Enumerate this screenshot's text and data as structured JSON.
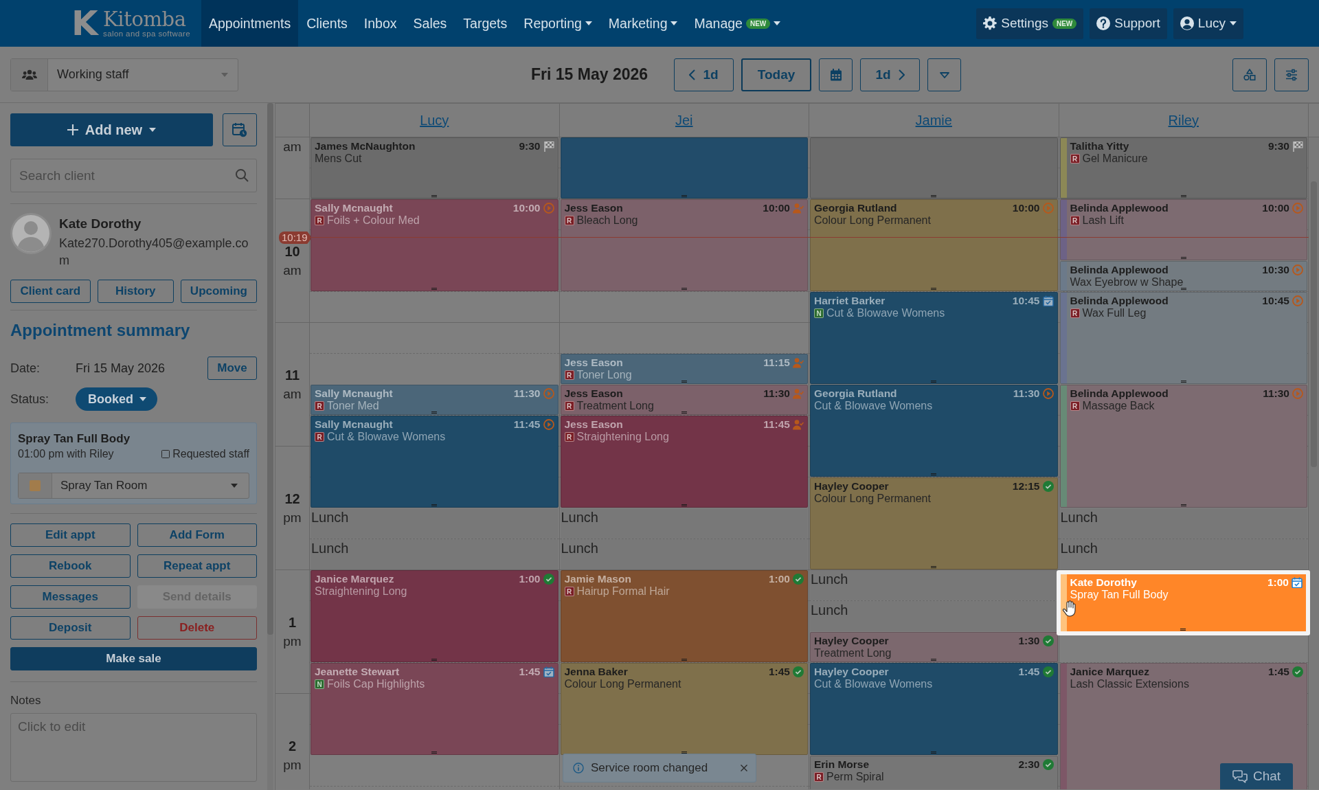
{
  "nav": {
    "logo": {
      "mark": "K",
      "name": "Kitomba",
      "tagline": "salon and spa software"
    },
    "items": [
      {
        "label": "Appointments",
        "selected": true,
        "menu": false
      },
      {
        "label": "Clients",
        "selected": false,
        "menu": false
      },
      {
        "label": "Inbox",
        "selected": false,
        "menu": false
      },
      {
        "label": "Sales",
        "selected": false,
        "menu": false
      },
      {
        "label": "Targets",
        "selected": false,
        "menu": false
      },
      {
        "label": "Reporting",
        "selected": false,
        "menu": true
      },
      {
        "label": "Marketing",
        "selected": false,
        "menu": true
      },
      {
        "label": "Manage",
        "selected": false,
        "menu": true,
        "badge": "NEW"
      }
    ],
    "settings": {
      "label": "Settings",
      "badge": "NEW"
    },
    "support": {
      "label": "Support"
    },
    "user": {
      "label": "Lucy"
    }
  },
  "toolbar": {
    "staff_filter": "Working staff",
    "date": "Fri 15 May 2026",
    "prev_day": "1d",
    "today": "Today",
    "next_day": "1d"
  },
  "sidebar": {
    "add_new": "Add new",
    "search": {
      "placeholder": "Search client"
    },
    "client": {
      "name": "Kate Dorothy",
      "email": "Kate270.Dorothy405@example.com"
    },
    "client_buttons": [
      "Client card",
      "History",
      "Upcoming"
    ],
    "summary": {
      "title": "Appointment summary",
      "date_label": "Date:",
      "date": "Fri 15 May 2026",
      "move": "Move",
      "status_label": "Status:",
      "status": "Booked"
    },
    "service": {
      "name": "Spray Tan Full Body",
      "detail": "01:00 pm with Riley",
      "requested_staff": {
        "label": "Requested staff",
        "checked": false
      },
      "room": {
        "name": "Spray Tan Room",
        "color": "#a27c4b"
      }
    },
    "actions": [
      {
        "label": "Edit appt",
        "kind": "outline",
        "disabled": false
      },
      {
        "label": "Add Form",
        "kind": "outline",
        "disabled": false
      },
      {
        "label": "Rebook",
        "kind": "outline",
        "disabled": false
      },
      {
        "label": "Repeat appt",
        "kind": "outline",
        "disabled": false
      },
      {
        "label": "Messages",
        "kind": "outline",
        "disabled": false
      },
      {
        "label": "Send details",
        "kind": "outline",
        "disabled": true
      },
      {
        "label": "Deposit",
        "kind": "outline",
        "disabled": false
      },
      {
        "label": "Delete",
        "kind": "danger",
        "disabled": false
      },
      {
        "label": "Make sale",
        "kind": "primary",
        "disabled": false
      }
    ],
    "notes": {
      "label": "Notes",
      "placeholder": "Click to edit"
    }
  },
  "calendar": {
    "current_time": "10:19",
    "time_labels": [
      {
        "period": "am"
      },
      {
        "hour": "10",
        "period": "am"
      },
      {
        "hour": "11",
        "period": "am"
      },
      {
        "hour": "12",
        "period": "pm"
      },
      {
        "hour": "1",
        "period": "pm"
      },
      {
        "hour": "2",
        "period": "pm"
      }
    ],
    "columns": [
      {
        "staff": "Lucy",
        "appointments": [
          {
            "kind": "appointment",
            "client": "James McNaughton",
            "time": "9:30",
            "status": {
              "kind": "completed"
            },
            "service": "Mens Cut",
            "color": "#6b6b6b",
            "selected": false
          },
          {
            "kind": "appointment",
            "client": "Sally Mcnaught",
            "time": "10:00",
            "status": {
              "kind": "started"
            },
            "badge": {
              "letter": "R",
              "kind": "rebooked"
            },
            "service": "Foils + Colour Med",
            "color": "#7a4656",
            "selected": false
          },
          {
            "kind": "appointment",
            "client": "Sally Mcnaught",
            "time": "11:30",
            "status": {
              "kind": "started"
            },
            "badge": {
              "letter": "R",
              "kind": "rebooked"
            },
            "service": "Toner Med",
            "color": "#4b6679",
            "selected": false
          },
          {
            "kind": "appointment",
            "client": "Sally Mcnaught",
            "time": "11:45",
            "status": {
              "kind": "started"
            },
            "badge": {
              "letter": "R",
              "kind": "rebooked"
            },
            "service": "Cut & Blowave Womens",
            "color": "#1f4b68",
            "selected": false
          },
          {
            "kind": "break",
            "label": "Lunch",
            "selected": false
          },
          {
            "kind": "break",
            "label": "Lunch",
            "selected": false
          },
          {
            "kind": "appointment",
            "client": "Janice Marquez",
            "time": "1:00",
            "status": {
              "kind": "arrived"
            },
            "service": "Straightening Long",
            "color": "#733448",
            "selected": false
          },
          {
            "kind": "appointment",
            "client": "Jeanette Stewart",
            "time": "1:45",
            "status": {
              "kind": "confirmed"
            },
            "badge": {
              "letter": "N",
              "kind": "new_client"
            },
            "service": "Foils Cap Highlights",
            "color": "#7a4656",
            "selected": false
          }
        ]
      },
      {
        "staff": "Jei",
        "appointments": [
          {
            "kind": "blank",
            "color": "#224c6a",
            "selected": false
          },
          {
            "kind": "appointment",
            "client": "Jess Eason",
            "time": "10:00",
            "status": {
              "kind": "requested"
            },
            "badge": {
              "letter": "R",
              "kind": "rebooked"
            },
            "service": "Bleach Long",
            "color": "#7c616a",
            "selected": false
          },
          {
            "kind": "appointment",
            "client": "Jess Eason",
            "time": "11:15",
            "status": {
              "kind": "requested"
            },
            "badge": {
              "letter": "R",
              "kind": "rebooked"
            },
            "service": "Toner Long",
            "color": "#4b6679",
            "selected": false
          },
          {
            "kind": "appointment",
            "client": "Jess Eason",
            "time": "11:30",
            "status": {
              "kind": "requested"
            },
            "badge": {
              "letter": "R",
              "kind": "rebooked"
            },
            "service": "Treatment Long",
            "color": "#7c616a",
            "selected": false
          },
          {
            "kind": "appointment",
            "client": "Jess Eason",
            "time": "11:45",
            "status": {
              "kind": "requested"
            },
            "badge": {
              "letter": "R",
              "kind": "rebooked"
            },
            "service": "Straightening Long",
            "color": "#733448",
            "selected": false
          },
          {
            "kind": "break",
            "label": "Lunch",
            "selected": false
          },
          {
            "kind": "break",
            "label": "Lunch",
            "selected": false
          },
          {
            "kind": "appointment",
            "client": "Jamie Mason",
            "time": "1:00",
            "status": {
              "kind": "arrived"
            },
            "badge": {
              "letter": "R",
              "kind": "rebooked"
            },
            "service": "Hairup Formal Hair",
            "color": "#7f5030",
            "selected": false
          },
          {
            "kind": "appointment",
            "client": "Jenna Baker",
            "time": "1:45",
            "status": {
              "kind": "arrived"
            },
            "service": "Colour Long Permanent",
            "color": "#7f704b",
            "selected": false
          }
        ]
      },
      {
        "staff": "Jamie",
        "appointments": [
          {
            "kind": "blank",
            "color": "#6b6b6b",
            "selected": false
          },
          {
            "kind": "appointment",
            "client": "Georgia Rutland",
            "time": "10:00",
            "status": {
              "kind": "started"
            },
            "service": "Colour Long Permanent",
            "color": "#7f704b",
            "selected": false
          },
          {
            "kind": "appointment",
            "client": "Harriet Barker",
            "time": "10:45",
            "status": {
              "kind": "confirmed"
            },
            "badge": {
              "letter": "N",
              "kind": "new_client"
            },
            "service": "Cut & Blowave Womens",
            "color": "#1f4b68",
            "selected": false
          },
          {
            "kind": "appointment",
            "client": "Georgia Rutland",
            "time": "11:30",
            "status": {
              "kind": "started"
            },
            "service": "Cut & Blowave Womens",
            "color": "#1f4b68",
            "selected": false
          },
          {
            "kind": "appointment",
            "client": "Hayley Cooper",
            "time": "12:15",
            "status": {
              "kind": "arrived"
            },
            "service": "Colour Long Permanent",
            "color": "#7f704b",
            "selected": false
          },
          {
            "kind": "break",
            "label": "Lunch",
            "selected": false
          },
          {
            "kind": "break",
            "label": "Lunch",
            "selected": false
          },
          {
            "kind": "appointment",
            "client": "Hayley Cooper",
            "time": "1:30",
            "status": {
              "kind": "arrived"
            },
            "service": "Treatment Long",
            "color": "#7c686e",
            "selected": false
          },
          {
            "kind": "appointment",
            "client": "Hayley Cooper",
            "time": "1:45",
            "status": {
              "kind": "arrived"
            },
            "service": "Cut & Blowave Womens",
            "color": "#1f4b68",
            "selected": false
          },
          {
            "kind": "appointment",
            "client": "Erin Morse",
            "time": "2:30",
            "status": {
              "kind": "arrived"
            },
            "badge": {
              "letter": "R",
              "kind": "rebooked"
            },
            "service": "Perm Spiral",
            "color": "#767676",
            "selected": false
          }
        ]
      },
      {
        "staff": "Riley",
        "appointments": [
          {
            "kind": "appointment",
            "client": "Talitha Yitty",
            "time": "9:30",
            "status": {
              "kind": "completed"
            },
            "badge": {
              "letter": "R",
              "kind": "rebooked"
            },
            "service": "Gel Manicure",
            "color": "#6b6b6b",
            "stripe": {
              "color": "#8c8856"
            },
            "selected": false
          },
          {
            "kind": "appointment",
            "client": "Belinda Applewood",
            "time": "10:00",
            "status": {
              "kind": "started"
            },
            "badge": {
              "letter": "R",
              "kind": "rebooked"
            },
            "service": "Lash Lift",
            "color": "#7d6b71",
            "stripe": {
              "color": "#6d6286"
            },
            "selected": false
          },
          {
            "kind": "appointment",
            "client": "Belinda Applewood",
            "time": "10:30",
            "status": {
              "kind": "started"
            },
            "service": "Wax Eyebrow w Shape",
            "color": "#737b81",
            "stripe": {
              "color": "#6c7a8a"
            },
            "selected": false
          },
          {
            "kind": "appointment",
            "client": "Belinda Applewood",
            "time": "10:45",
            "status": {
              "kind": "started"
            },
            "badge": {
              "letter": "R",
              "kind": "rebooked"
            },
            "service": "Wax Full Leg",
            "color": "#737b81",
            "stripe": {
              "color": "#6a7390"
            },
            "selected": false
          },
          {
            "kind": "appointment",
            "client": "Belinda Applewood",
            "time": "11:30",
            "status": {
              "kind": "started"
            },
            "badge": {
              "letter": "R",
              "kind": "rebooked"
            },
            "service": "Massage Back",
            "color": "#7d6b71",
            "stripe": {
              "color": "#678a76"
            },
            "selected": false
          },
          {
            "kind": "break",
            "label": "Lunch",
            "selected": false
          },
          {
            "kind": "break",
            "label": "Lunch",
            "selected": false
          },
          {
            "kind": "appointment",
            "client": "Kate Dorothy",
            "time": "1:00",
            "status": {
              "kind": "confirmed"
            },
            "service": "Spray Tan Full Body",
            "color": "#ff8628",
            "stripe": {
              "color": "#ffc37d"
            },
            "selected": true
          },
          {
            "kind": "appointment",
            "client": "Janice Marquez",
            "time": "1:45",
            "status": {
              "kind": "arrived"
            },
            "service": "Lash Classic Extensions",
            "color": "#7d6b71",
            "stripe": {
              "color": "#7d5767"
            },
            "selected": false
          }
        ]
      }
    ]
  },
  "toast": {
    "message": "Service room changed"
  },
  "chat": {
    "label": "Chat"
  }
}
